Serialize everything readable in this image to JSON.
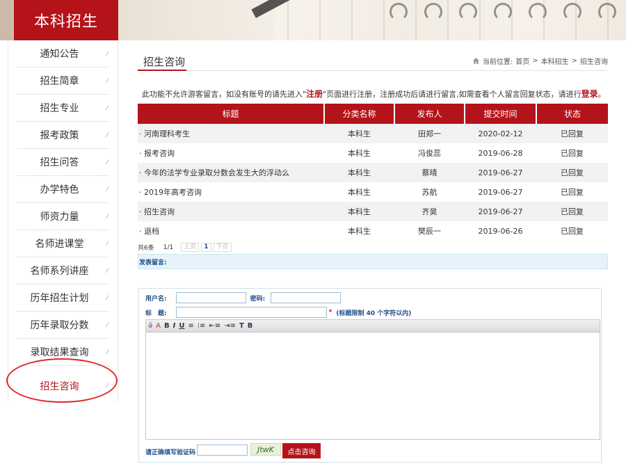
{
  "brand": {
    "title": "本科招生"
  },
  "sidebar": {
    "items": [
      {
        "label": "通知公告"
      },
      {
        "label": "招生简章"
      },
      {
        "label": "招生专业"
      },
      {
        "label": "报考政策"
      },
      {
        "label": "招生问答"
      },
      {
        "label": "办学特色"
      },
      {
        "label": "师资力量"
      },
      {
        "label": "名师进课堂"
      },
      {
        "label": "名师系列讲座"
      },
      {
        "label": "历年招生计划"
      },
      {
        "label": "历年录取分数"
      },
      {
        "label": "录取结果查询"
      },
      {
        "label": "招生咨询",
        "active": true
      }
    ],
    "arrow": "⁄"
  },
  "page": {
    "title": "招生咨询",
    "breadcrumb": {
      "prefix": "当前位置:",
      "home": "首页",
      "sep": ">",
      "level1": "本科招生",
      "level2": "招生咨询"
    },
    "notice": {
      "part1": "此功能不允许游客留言，如没有账号的请先进入\"",
      "register": "注册",
      "part2": "\"页面进行注册，注册成功后请进行留言,如需查看个人留言回复状态，请进行",
      "login": "登录",
      "part3": "。"
    }
  },
  "table": {
    "headers": [
      "标题",
      "分类名称",
      "发布人",
      "提交时间",
      "状态"
    ],
    "rows": [
      {
        "title": "· 河南理科考生",
        "category": "本科生",
        "author": "田郑一",
        "date": "2020-02-12",
        "status": "已回复"
      },
      {
        "title": "· 报考咨询",
        "category": "本科生",
        "author": "冯俊蕊",
        "date": "2019-06-28",
        "status": "已回复"
      },
      {
        "title": "· 今年的法学专业录取分数会发生大的浮动么",
        "category": "本科生",
        "author": "蔡晴",
        "date": "2019-06-27",
        "status": "已回复"
      },
      {
        "title": "· 2019年高考咨询",
        "category": "本科生",
        "author": "苏航",
        "date": "2019-06-27",
        "status": "已回复"
      },
      {
        "title": "· 招生咨询",
        "category": "本科生",
        "author": "齐昊",
        "date": "2019-06-27",
        "status": "已回复"
      },
      {
        "title": "· 退档",
        "category": "本科生",
        "author": "樊辰一",
        "date": "2019-06-26",
        "status": "已回复"
      }
    ]
  },
  "pager": {
    "count": "共6条",
    "pages": "1/1",
    "prev": "上页",
    "current": "1",
    "next": "下页"
  },
  "post": {
    "bar_label": "发表留言:",
    "username_label": "用户名:",
    "password_label": "密码:",
    "subject_label": "标　题:",
    "required_mark": "*",
    "subject_hint": "(标题限制 40 个字符以内)",
    "toolbar": [
      "ǝ̄",
      "A",
      "B",
      "I",
      "U",
      "≡",
      "⁝≡",
      "⇤≡",
      "⇥≡",
      "T",
      "B"
    ],
    "captcha_label": "请正确填写验证码",
    "captcha_code": "JtwK",
    "submit_label": "点击咨询"
  }
}
